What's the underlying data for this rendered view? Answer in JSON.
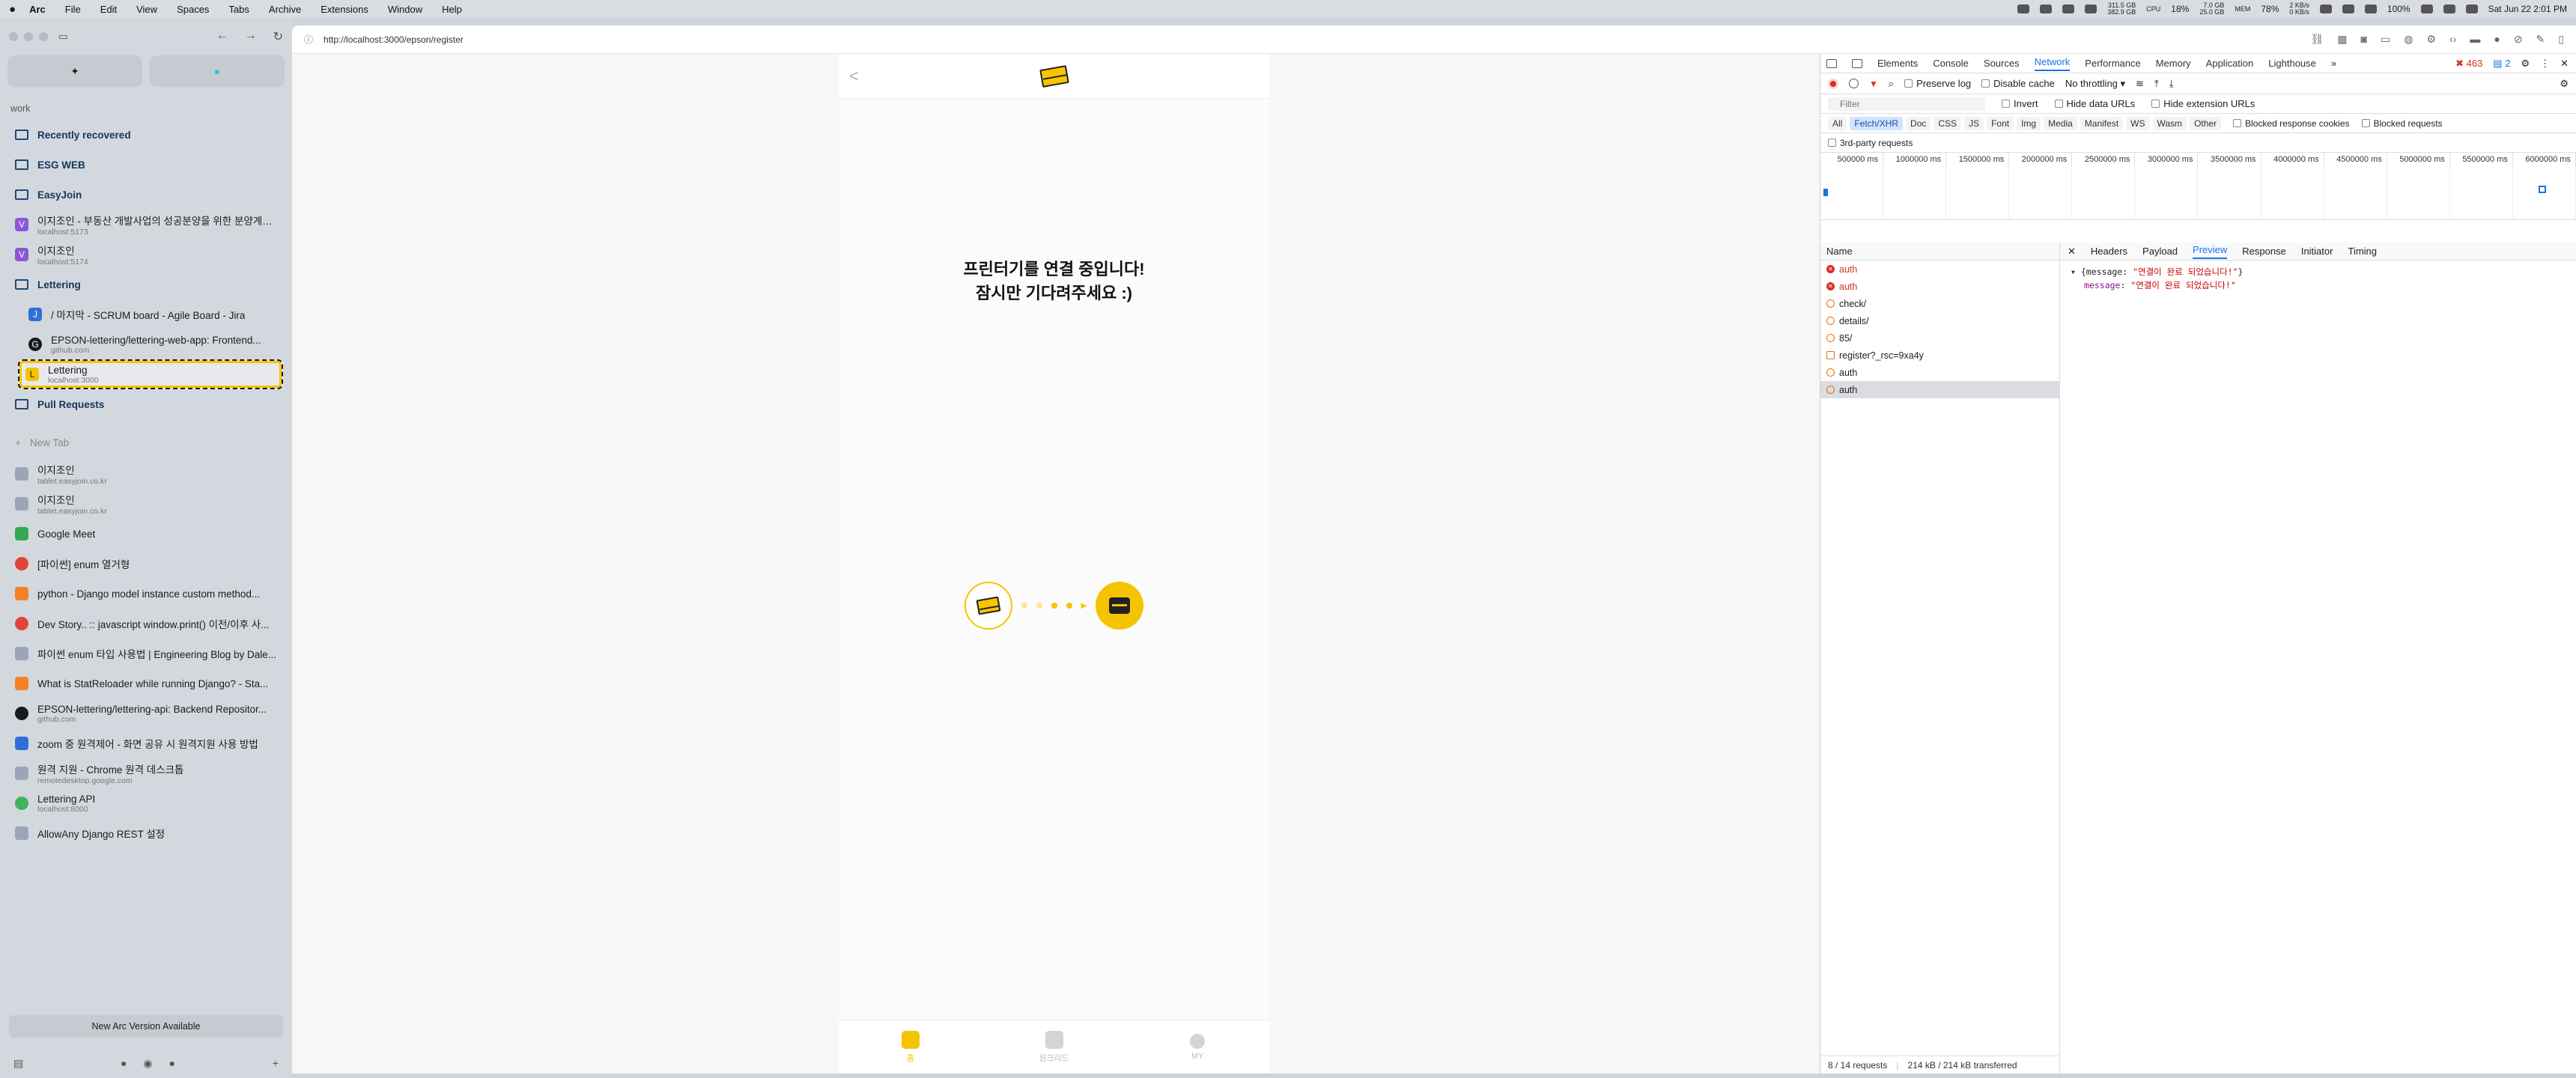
{
  "menubar": {
    "apple": "",
    "items": [
      "Arc",
      "File",
      "Edit",
      "View",
      "Spaces",
      "Tabs",
      "Archive",
      "Extensions",
      "Window",
      "Help"
    ],
    "stats": {
      "disk": [
        "311.5 GB",
        "382.9 GB"
      ],
      "cpu_label": "CPU",
      "cpu": "18%",
      "mem": [
        "7.0 GB",
        "25.0 GB"
      ],
      "mem_label": "MEM",
      "mem_pct": "78%",
      "net": [
        "2 KB/s",
        "0 KB/s"
      ],
      "battery": "100%",
      "datetime": "Sat Jun 22  2:01 PM"
    }
  },
  "sidebar": {
    "space_name": "work",
    "folders_top": [
      {
        "label": "Recently recovered"
      },
      {
        "label": "ESG WEB"
      },
      {
        "label": "EasyJoin"
      }
    ],
    "easyjoin_items": [
      {
        "title": "이지조인 - 부동산 개발사업의 성공분양을 위한 분양계약...",
        "sub": "localhost:5173",
        "icon": "V"
      },
      {
        "title": "이지조인",
        "sub": "localhost:5174",
        "icon": "V"
      }
    ],
    "lettering_folder": "Lettering",
    "lettering_items": [
      {
        "title": "/ 마지막 - SCRUM board - Agile Board - Jira",
        "sub": "",
        "icon": "J"
      },
      {
        "title": "EPSON-lettering/lettering-web-app: Frontend...",
        "sub": "github.com",
        "icon": "G"
      },
      {
        "title": "Lettering",
        "sub": "localhost:3000",
        "icon": "L"
      }
    ],
    "pull_requests": "Pull Requests",
    "new_tab": "New Tab",
    "tabs": [
      {
        "title": "이지조인",
        "sub": "tablet.easyjoin.co.kr",
        "icon": "e"
      },
      {
        "title": "이지조인",
        "sub": "tablet.easyjoin.co.kr",
        "icon": "e"
      },
      {
        "title": "Google Meet",
        "sub": "",
        "icon": "m"
      },
      {
        "title": "[파이썬] enum 열거형",
        "sub": "",
        "icon": "r"
      },
      {
        "title": "python - Django model instance custom method...",
        "sub": "",
        "icon": "s"
      },
      {
        "title": "Dev Story.. :: javascript window.print() 이전/이후 사...",
        "sub": "",
        "icon": "r"
      },
      {
        "title": "파이썬 enum 타입 사용법 | Engineering Blog by Dale...",
        "sub": "",
        "icon": "e"
      },
      {
        "title": "What is StatReloader while running Django? - Sta...",
        "sub": "",
        "icon": "s"
      },
      {
        "title": "EPSON-lettering/lettering-api: Backend Repositor...",
        "sub": "github.com",
        "icon": "G"
      },
      {
        "title": "zoom 중 원격제어 - 화면 공유 시 원격지원 사용 방법",
        "sub": "",
        "icon": "z"
      },
      {
        "title": "원격 지원 - Chrome 원격 데스크톱",
        "sub": "remotedesktop.google.com",
        "icon": "c"
      },
      {
        "title": "Lettering API",
        "sub": "localhost:8000",
        "icon": "D"
      },
      {
        "title": "AllowAny Django REST 설정",
        "sub": "",
        "icon": "o"
      }
    ],
    "update_label": "New Arc Version Available"
  },
  "browser": {
    "url": "http://localhost:3000/epson/register"
  },
  "app": {
    "back": "<",
    "message_line1": "프린터기를 연결 중입니다!",
    "message_line2": "잠시만 기다려주세요 :)",
    "tabs": [
      {
        "label": "홈",
        "active": true
      },
      {
        "label": "원크리드",
        "active": false
      },
      {
        "label": "MY",
        "active": false
      }
    ]
  },
  "devtools": {
    "tabs": [
      "Elements",
      "Console",
      "Sources",
      "Network",
      "Performance",
      "Memory",
      "Application",
      "Lighthouse"
    ],
    "active_tab": "Network",
    "errors": "463",
    "messages": "2",
    "toolbar": {
      "preserve_log": "Preserve log",
      "disable_cache": "Disable cache",
      "throttling": "No throttling"
    },
    "filter": {
      "placeholder": "Filter",
      "invert": "Invert",
      "hide_data": "Hide data URLs",
      "hide_ext": "Hide extension URLs"
    },
    "types": [
      "All",
      "Fetch/XHR",
      "Doc",
      "CSS",
      "JS",
      "Font",
      "Img",
      "Media",
      "Manifest",
      "WS",
      "Wasm",
      "Other"
    ],
    "active_type": "Fetch/XHR",
    "blocked_cookies": "Blocked response cookies",
    "blocked_requests": "Blocked requests",
    "third_party": "3rd-party requests",
    "timeline_ticks": [
      "500000 ms",
      "1000000 ms",
      "1500000 ms",
      "2000000 ms",
      "2500000 ms",
      "3000000 ms",
      "3500000 ms",
      "4000000 ms",
      "4500000 ms",
      "5000000 ms",
      "5500000 ms",
      "6000000 ms"
    ],
    "list_header": "Name",
    "requests": [
      {
        "name": "auth",
        "kind": "err"
      },
      {
        "name": "auth",
        "kind": "err"
      },
      {
        "name": "check/",
        "kind": "xhr"
      },
      {
        "name": "details/",
        "kind": "xhr"
      },
      {
        "name": "85/",
        "kind": "xhr"
      },
      {
        "name": "register?_rsc=9xa4y",
        "kind": "doc"
      },
      {
        "name": "auth",
        "kind": "xhr"
      },
      {
        "name": "auth",
        "kind": "xhr",
        "selected": true
      }
    ],
    "status": {
      "requests": "8 / 14 requests",
      "transferred": "214 kB / 214 kB transferred"
    },
    "detail_tabs": [
      "Headers",
      "Payload",
      "Preview",
      "Response",
      "Initiator",
      "Timing"
    ],
    "active_detail_tab": "Preview",
    "preview": {
      "summary_prefix": "▾ {message: ",
      "summary_value": "\"연결이 완료 되었습니다!\"",
      "summary_suffix": "}",
      "key": "message",
      "value": "\"연결이 완료 되었습니다!\""
    }
  }
}
